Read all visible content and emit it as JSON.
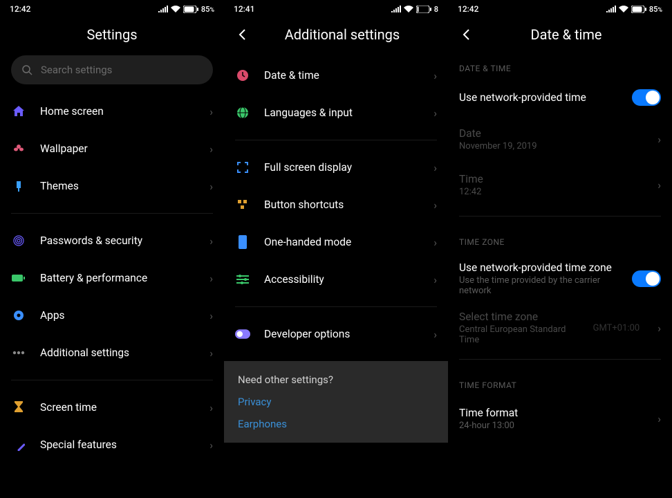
{
  "screen1": {
    "status": {
      "time": "12:42",
      "battery": "85"
    },
    "title": "Settings",
    "search_placeholder": "Search settings",
    "group1": [
      {
        "label": "Home screen",
        "color": "#6b5cff",
        "icon": "home"
      },
      {
        "label": "Wallpaper",
        "color": "#e05a7a",
        "icon": "flower"
      },
      {
        "label": "Themes",
        "color": "#3aa0ff",
        "icon": "brush"
      }
    ],
    "group2": [
      {
        "label": "Passwords & security",
        "color": "#6b5cff",
        "icon": "fingerprint"
      },
      {
        "label": "Battery & performance",
        "color": "#3ac76a",
        "icon": "battery"
      },
      {
        "label": "Apps",
        "color": "#3a8fff",
        "icon": "gear"
      },
      {
        "label": "Additional settings",
        "color": "#888",
        "icon": "dots"
      }
    ],
    "group3": [
      {
        "label": "Screen time",
        "color": "#e0a030",
        "icon": "hourglass"
      },
      {
        "label": "Special features",
        "color": "#6b5cff",
        "icon": "wand"
      }
    ]
  },
  "screen2": {
    "status": {
      "time": "12:41",
      "battery": "8"
    },
    "title": "Additional settings",
    "group1": [
      {
        "label": "Date & time",
        "color": "#d94a6a",
        "icon": "clock"
      },
      {
        "label": "Languages & input",
        "color": "#3ac76a",
        "icon": "globe"
      }
    ],
    "group2": [
      {
        "label": "Full screen display",
        "color": "#3a8fff",
        "icon": "fullscreen"
      },
      {
        "label": "Button shortcuts",
        "color": "#e0a030",
        "icon": "blocks"
      },
      {
        "label": "One-handed mode",
        "color": "#3a8fff",
        "icon": "phone"
      },
      {
        "label": "Accessibility",
        "color": "#3ac76a",
        "icon": "sliders"
      }
    ],
    "group3": [
      {
        "label": "Developer options",
        "color": "#8a7aff",
        "icon": "dev-toggle"
      }
    ],
    "other": {
      "question": "Need other settings?",
      "links": [
        "Privacy",
        "Earphones"
      ]
    }
  },
  "screen3": {
    "status": {
      "time": "12:42",
      "battery": "85"
    },
    "title": "Date & time",
    "section_datetime": "DATE & TIME",
    "use_network_time": "Use network-provided time",
    "date_label": "Date",
    "date_value": "November 19, 2019",
    "time_label": "Time",
    "time_value": "12:42",
    "section_tz": "TIME ZONE",
    "use_network_tz": "Use network-provided time zone",
    "use_network_tz_sub": "Use the time provided by the carrier network",
    "select_tz": "Select time zone",
    "select_tz_sub": "Central European Standard Time",
    "tz_offset": "GMT+01:00",
    "section_format": "TIME FORMAT",
    "time_format": "Time format",
    "time_format_sub": "24-hour 13:00"
  }
}
